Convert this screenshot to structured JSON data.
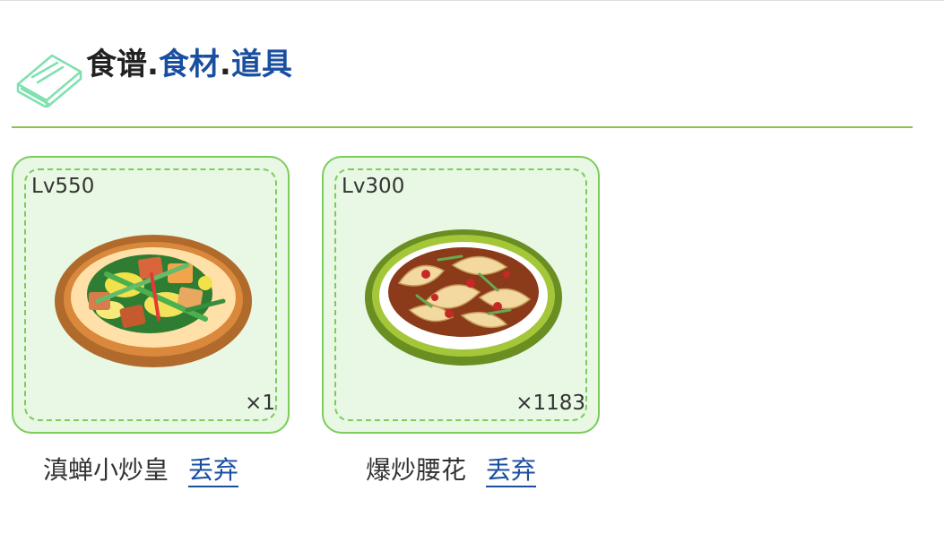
{
  "header": {
    "title_main": "食谱",
    "sep1": ".",
    "tab_ingredients": "食材",
    "sep2": ".",
    "tab_items": "道具",
    "icon": "book-icon"
  },
  "recipes": [
    {
      "level": "Lv550",
      "count": "×1",
      "name": "滇蝉小炒皇",
      "discard_label": "丢弃",
      "image": "stir-fry-dish-image"
    },
    {
      "level": "Lv300",
      "count": "×1183",
      "name": "爆炒腰花",
      "discard_label": "丢弃",
      "image": "kidney-stir-fry-dish-image"
    }
  ],
  "colors": {
    "accent_green": "#7ccc5c",
    "card_bg": "#e8f8e4",
    "link_blue": "#1a4fa0",
    "divider": "#8bc34a"
  }
}
